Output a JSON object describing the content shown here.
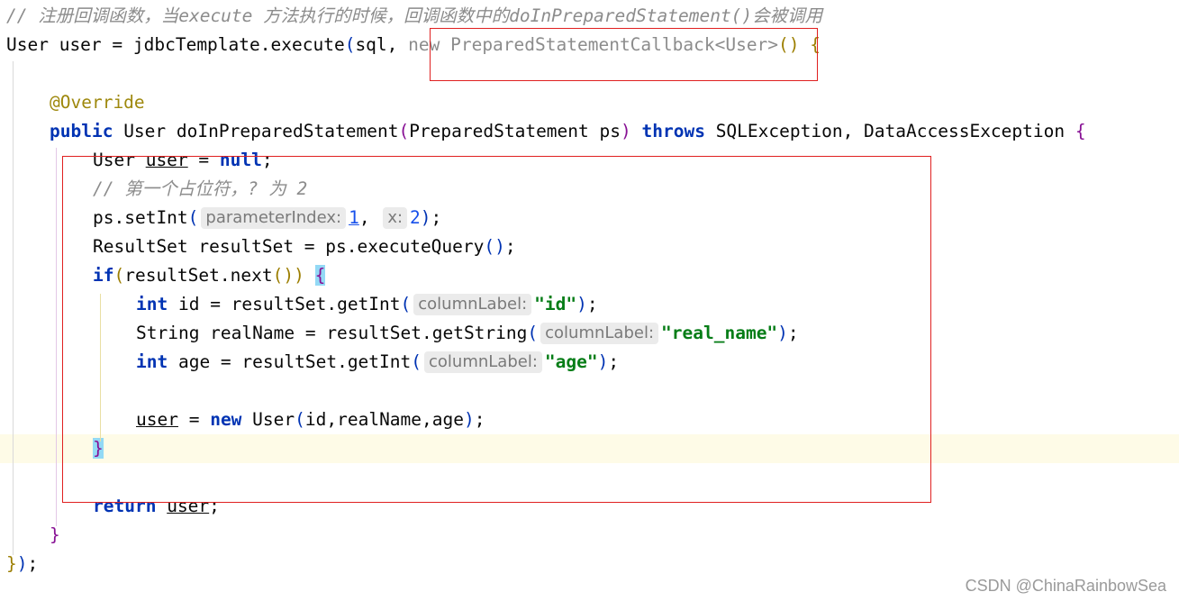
{
  "lines": [
    {
      "indent": 1,
      "tokens": [
        {
          "t": "// 注册回调函数，当execute 方法执行的时候，回调函数中的doInPreparedStatement()会被调用",
          "c": "comment"
        }
      ]
    },
    {
      "indent": 1,
      "tokens": [
        {
          "t": "User user = jdbcTemplate.execute",
          "c": ""
        },
        {
          "t": "(",
          "c": "p1"
        },
        {
          "t": "sql, ",
          "c": ""
        },
        {
          "t": "new PreparedStatementCallback<User>",
          "c": "gray"
        },
        {
          "t": "()",
          "c": "p2"
        },
        {
          "t": " ",
          "c": ""
        },
        {
          "t": "{",
          "c": "p2"
        }
      ]
    },
    {
      "indent": 1,
      "tokens": []
    },
    {
      "indent": 3,
      "tokens": [
        {
          "t": "@Override",
          "c": "ann"
        }
      ]
    },
    {
      "indent": 3,
      "tokens": [
        {
          "t": "public",
          "c": "kw"
        },
        {
          "t": " User doInPreparedStatement",
          "c": ""
        },
        {
          "t": "(",
          "c": "p3"
        },
        {
          "t": "PreparedStatement ps",
          "c": ""
        },
        {
          "t": ")",
          "c": "p3"
        },
        {
          "t": " ",
          "c": ""
        },
        {
          "t": "throws",
          "c": "kw"
        },
        {
          "t": " SQLException, DataAccessException ",
          "c": ""
        },
        {
          "t": "{",
          "c": "p3"
        }
      ]
    },
    {
      "indent": 5,
      "tokens": [
        {
          "t": "User ",
          "c": ""
        },
        {
          "t": "user",
          "c": "ul"
        },
        {
          "t": " = ",
          "c": ""
        },
        {
          "t": "null",
          "c": "kw"
        },
        {
          "t": ";",
          "c": ""
        }
      ]
    },
    {
      "indent": 5,
      "tokens": [
        {
          "t": "// 第一个占位符，? 为 2",
          "c": "comment"
        }
      ]
    },
    {
      "indent": 5,
      "tokens": [
        {
          "t": "ps.setInt",
          "c": ""
        },
        {
          "t": "(",
          "c": "p1"
        },
        {
          "h": "parameterIndex:"
        },
        {
          "t": "1",
          "c": "num ul"
        },
        {
          "t": ", ",
          "c": ""
        },
        {
          "h": "x:"
        },
        {
          "t": "2",
          "c": "num"
        },
        {
          "t": ")",
          "c": "p1"
        },
        {
          "t": ";",
          "c": ""
        }
      ]
    },
    {
      "indent": 5,
      "tokens": [
        {
          "t": "ResultSet resultSet = ps.executeQuery",
          "c": ""
        },
        {
          "t": "()",
          "c": "p1"
        },
        {
          "t": ";",
          "c": ""
        }
      ]
    },
    {
      "indent": 5,
      "tokens": [
        {
          "t": "if",
          "c": "kw"
        },
        {
          "t": "(",
          "c": "p2"
        },
        {
          "t": "resultSet.next",
          "c": ""
        },
        {
          "t": "())",
          "c": "p2"
        },
        {
          "t": " ",
          "c": ""
        },
        {
          "t": "{",
          "c": "p3 bh"
        }
      ]
    },
    {
      "indent": 7,
      "tokens": [
        {
          "t": "int",
          "c": "kw"
        },
        {
          "t": " id = resultSet.getInt",
          "c": ""
        },
        {
          "t": "(",
          "c": "p1"
        },
        {
          "h": "columnLabel:"
        },
        {
          "t": "\"id\"",
          "c": "str"
        },
        {
          "t": ")",
          "c": "p1"
        },
        {
          "t": ";",
          "c": ""
        }
      ]
    },
    {
      "indent": 7,
      "tokens": [
        {
          "t": "String realName = resultSet.getString",
          "c": ""
        },
        {
          "t": "(",
          "c": "p1"
        },
        {
          "h": "columnLabel:"
        },
        {
          "t": "\"real_name\"",
          "c": "str"
        },
        {
          "t": ")",
          "c": "p1"
        },
        {
          "t": ";",
          "c": ""
        }
      ]
    },
    {
      "indent": 7,
      "tokens": [
        {
          "t": "int",
          "c": "kw"
        },
        {
          "t": " age = resultSet.getInt",
          "c": ""
        },
        {
          "t": "(",
          "c": "p1"
        },
        {
          "h": "columnLabel:"
        },
        {
          "t": "\"age\"",
          "c": "str"
        },
        {
          "t": ")",
          "c": "p1"
        },
        {
          "t": ";",
          "c": ""
        }
      ]
    },
    {
      "indent": 7,
      "tokens": []
    },
    {
      "indent": 7,
      "tokens": [
        {
          "t": "user",
          "c": "ul"
        },
        {
          "t": " = ",
          "c": ""
        },
        {
          "t": "new",
          "c": "kw"
        },
        {
          "t": " User",
          "c": ""
        },
        {
          "t": "(",
          "c": "p1"
        },
        {
          "t": "id,realName,age",
          "c": ""
        },
        {
          "t": ")",
          "c": "p1"
        },
        {
          "t": ";",
          "c": ""
        }
      ]
    },
    {
      "indent": 5,
      "current": true,
      "tokens": [
        {
          "t": "}",
          "c": "p3 bh"
        }
      ]
    },
    {
      "indent": 5,
      "tokens": []
    },
    {
      "indent": 5,
      "tokens": [
        {
          "t": "return",
          "c": "kw"
        },
        {
          "t": " ",
          "c": ""
        },
        {
          "t": "user",
          "c": "ul"
        },
        {
          "t": ";",
          "c": ""
        }
      ]
    },
    {
      "indent": 3,
      "tokens": [
        {
          "t": "}",
          "c": "p3"
        }
      ]
    },
    {
      "indent": 1,
      "tokens": [
        {
          "t": "}",
          "c": "p2"
        },
        {
          "t": ")",
          "c": "p1"
        },
        {
          "t": ";",
          "c": ""
        }
      ]
    }
  ],
  "watermark": "CSDN @ChinaRainbowSea",
  "colors": {
    "keyword": "#0033b3",
    "string": "#067d17",
    "comment": "#8c8c8c",
    "annotation": "#9e880d",
    "number": "#1750eb",
    "highlight_box": "#e02020",
    "current_line": "#fefbe7",
    "brace_match": "#93d9f5"
  }
}
